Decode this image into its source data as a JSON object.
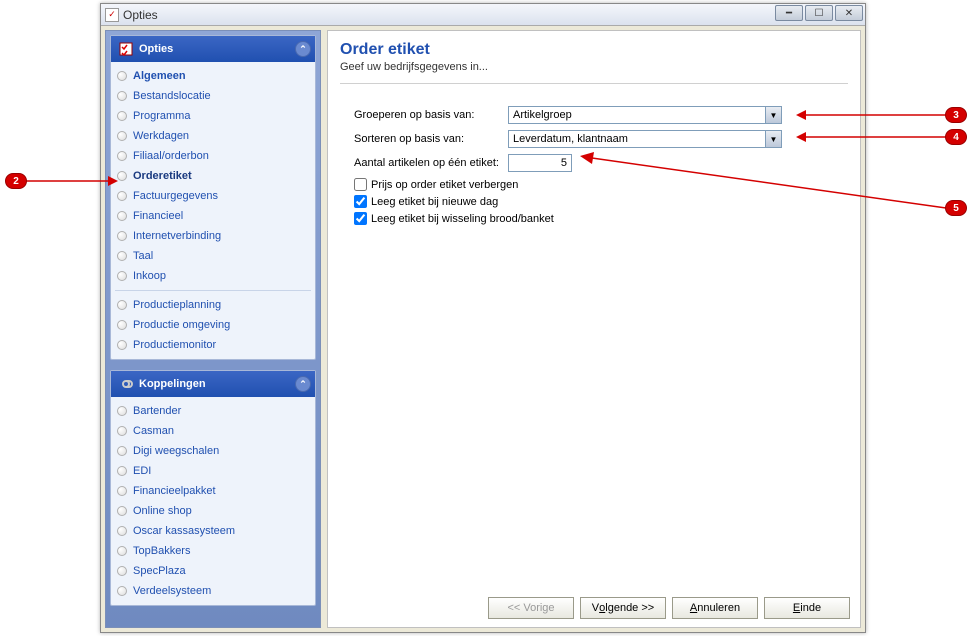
{
  "window": {
    "title": "Opties"
  },
  "sidebar": {
    "panels": [
      {
        "title": "Opties",
        "groups": [
          [
            {
              "label": "Algemeen",
              "bold": true
            },
            {
              "label": "Bestandslocatie"
            },
            {
              "label": "Programma"
            },
            {
              "label": "Werkdagen"
            },
            {
              "label": "Filiaal/orderbon"
            },
            {
              "label": "Orderetiket",
              "selected": true
            },
            {
              "label": "Factuurgegevens"
            },
            {
              "label": "Financieel"
            },
            {
              "label": "Internetverbinding"
            },
            {
              "label": "Taal"
            },
            {
              "label": "Inkoop"
            }
          ],
          [
            {
              "label": "Productieplanning"
            },
            {
              "label": "Productie omgeving"
            },
            {
              "label": "Productiemonitor"
            }
          ]
        ]
      },
      {
        "title": "Koppelingen",
        "groups": [
          [
            {
              "label": "Bartender"
            },
            {
              "label": "Casman"
            },
            {
              "label": "Digi weegschalen"
            },
            {
              "label": "EDI"
            },
            {
              "label": "Financieelpakket"
            },
            {
              "label": "Online shop"
            },
            {
              "label": "Oscar kassasysteem"
            },
            {
              "label": "TopBakkers"
            },
            {
              "label": "SpecPlaza"
            },
            {
              "label": "Verdeelsysteem"
            }
          ]
        ]
      }
    ]
  },
  "page": {
    "title": "Order etiket",
    "subtitle": "Geef uw bedrijfsgegevens in...",
    "labels": {
      "group_by": "Groeperen op basis van:",
      "sort_by": "Sorteren op basis van:",
      "articles_per_label": "Aantal artikelen op één etiket:"
    },
    "values": {
      "group_by": "Artikelgroep",
      "sort_by": "Leverdatum, klantnaam",
      "articles_per_label": "5"
    },
    "checks": {
      "hide_price": {
        "label": "Prijs op order etiket verbergen",
        "checked": false
      },
      "empty_new_day": {
        "label": "Leeg etiket bij nieuwe dag",
        "checked": true
      },
      "empty_switch": {
        "label": "Leeg etiket bij wisseling brood/banket",
        "checked": true
      }
    }
  },
  "buttons": {
    "prev": "<< Vorige",
    "next_prefix": "V",
    "next_accel": "o",
    "next_suffix": "lgende >>",
    "cancel_prefix": "",
    "cancel_accel": "A",
    "cancel_suffix": "nnuleren",
    "end_accel": "E",
    "end_suffix": "inde"
  },
  "callouts": {
    "c2": "2",
    "c3": "3",
    "c4": "4",
    "c5": "5"
  }
}
